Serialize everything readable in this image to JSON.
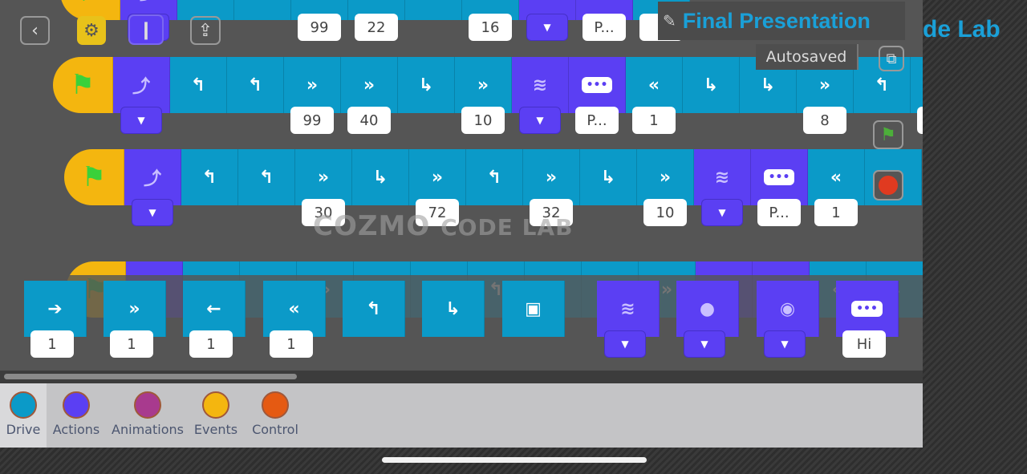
{
  "app": {
    "title": "Final Presentation",
    "background_title": "de Lab",
    "autosave_status": "Autosaved",
    "watermark": "COZMO",
    "watermark_small": "CODE LAB"
  },
  "toolbar": {
    "back": "back-icon",
    "hint": "lightbulb-icon",
    "robot": "robot-icon",
    "share": "share-icon"
  },
  "side_buttons": {
    "play": "green-flag-icon",
    "stop": "stop-icon",
    "expand": "expand-icon"
  },
  "colors": {
    "drive": "#0b9ac8",
    "actions": "#5b3ff3",
    "animations": "#a83a8e",
    "events": "#f4b60f",
    "control": "#e55a12",
    "canvas": "#555555",
    "title": "#1aa0d8"
  },
  "rows": [
    [
      {
        "t": "event",
        "i": "flag"
      },
      {
        "t": "action",
        "i": "lift",
        "dd": true
      },
      {
        "t": "drive",
        "i": "turn-left"
      },
      {
        "t": "drive",
        "i": "turn-left"
      },
      {
        "t": "drive",
        "i": "forward-fast",
        "v": "99"
      },
      {
        "t": "drive",
        "i": "forward-fast",
        "v": "22"
      },
      {
        "t": "drive",
        "i": "turn-right"
      },
      {
        "t": "drive",
        "i": "forward-fast",
        "v": "16"
      },
      {
        "t": "action",
        "i": "animation",
        "dd": true
      },
      {
        "t": "action",
        "i": "say",
        "v": "P..."
      },
      {
        "t": "drive",
        "i": "backward-fast",
        "v": "1"
      }
    ],
    [
      {
        "t": "event",
        "i": "flag"
      },
      {
        "t": "action",
        "i": "lift",
        "dd": true
      },
      {
        "t": "drive",
        "i": "turn-left"
      },
      {
        "t": "drive",
        "i": "turn-left"
      },
      {
        "t": "drive",
        "i": "forward-fast",
        "v": "99"
      },
      {
        "t": "drive",
        "i": "forward-fast",
        "v": "40"
      },
      {
        "t": "drive",
        "i": "turn-right"
      },
      {
        "t": "drive",
        "i": "forward-fast",
        "v": "10"
      },
      {
        "t": "action",
        "i": "animation",
        "dd": true
      },
      {
        "t": "action",
        "i": "say",
        "v": "P..."
      },
      {
        "t": "drive",
        "i": "backward-fast",
        "v": "1"
      },
      {
        "t": "drive",
        "i": "turn-right"
      },
      {
        "t": "drive",
        "i": "turn-right"
      },
      {
        "t": "drive",
        "i": "forward-fast",
        "v": "8"
      },
      {
        "t": "drive",
        "i": "turn-left"
      },
      {
        "t": "drive",
        "i": "forward-fast",
        "v": ""
      }
    ],
    [
      {
        "t": "event",
        "i": "flag"
      },
      {
        "t": "action",
        "i": "lift",
        "dd": true
      },
      {
        "t": "drive",
        "i": "turn-left"
      },
      {
        "t": "drive",
        "i": "turn-left"
      },
      {
        "t": "drive",
        "i": "forward-fast",
        "v": "30"
      },
      {
        "t": "drive",
        "i": "turn-right"
      },
      {
        "t": "drive",
        "i": "forward-fast",
        "v": "72"
      },
      {
        "t": "drive",
        "i": "turn-left"
      },
      {
        "t": "drive",
        "i": "forward-fast",
        "v": "32"
      },
      {
        "t": "drive",
        "i": "turn-right"
      },
      {
        "t": "drive",
        "i": "forward-fast",
        "v": "10"
      },
      {
        "t": "action",
        "i": "animation",
        "dd": true
      },
      {
        "t": "action",
        "i": "say",
        "v": "P..."
      },
      {
        "t": "drive",
        "i": "backward-fast",
        "v": "1"
      },
      {
        "t": "drive",
        "i": "turn-right"
      }
    ],
    [
      {
        "t": "event",
        "i": "flag"
      },
      {
        "t": "action",
        "i": "lift"
      },
      {
        "t": "drive",
        "i": "turn-left"
      },
      {
        "t": "drive",
        "i": "turn-left"
      },
      {
        "t": "drive",
        "i": "forward-fast"
      },
      {
        "t": "drive",
        "i": "turn-right"
      },
      {
        "t": "drive",
        "i": "forward-fast"
      },
      {
        "t": "drive",
        "i": "turn-left"
      },
      {
        "t": "drive",
        "i": "forward-fast"
      },
      {
        "t": "drive",
        "i": "turn-right"
      },
      {
        "t": "drive",
        "i": "forward-fast"
      },
      {
        "t": "action",
        "i": "animation"
      },
      {
        "t": "action",
        "i": "say"
      },
      {
        "t": "drive",
        "i": "backward-fast"
      },
      {
        "t": "drive",
        "i": "turn-right"
      }
    ]
  ],
  "palette": [
    {
      "t": "drive",
      "i": "forward",
      "v": "1"
    },
    {
      "t": "drive",
      "i": "forward-fast",
      "v": "1"
    },
    {
      "t": "drive",
      "i": "backward",
      "v": "1"
    },
    {
      "t": "drive",
      "i": "backward-fast",
      "v": "1"
    },
    {
      "t": "drive",
      "i": "turn-left"
    },
    {
      "t": "drive",
      "i": "turn-right"
    },
    {
      "t": "drive",
      "i": "dock-cube"
    },
    {
      "t": "action",
      "i": "animation",
      "dd": true
    },
    {
      "t": "action",
      "i": "cube-lift",
      "dd": true
    },
    {
      "t": "action",
      "i": "face-alert",
      "dd": true
    },
    {
      "t": "action",
      "i": "say",
      "v": "Hi"
    }
  ],
  "categories": [
    {
      "label": "Drive",
      "color": "#0b9ac8",
      "selected": true
    },
    {
      "label": "Actions",
      "color": "#5b3ff3"
    },
    {
      "label": "Animations",
      "color": "#a83a8e"
    },
    {
      "label": "Events",
      "color": "#f4b60f"
    },
    {
      "label": "Control",
      "color": "#e55a12"
    }
  ]
}
